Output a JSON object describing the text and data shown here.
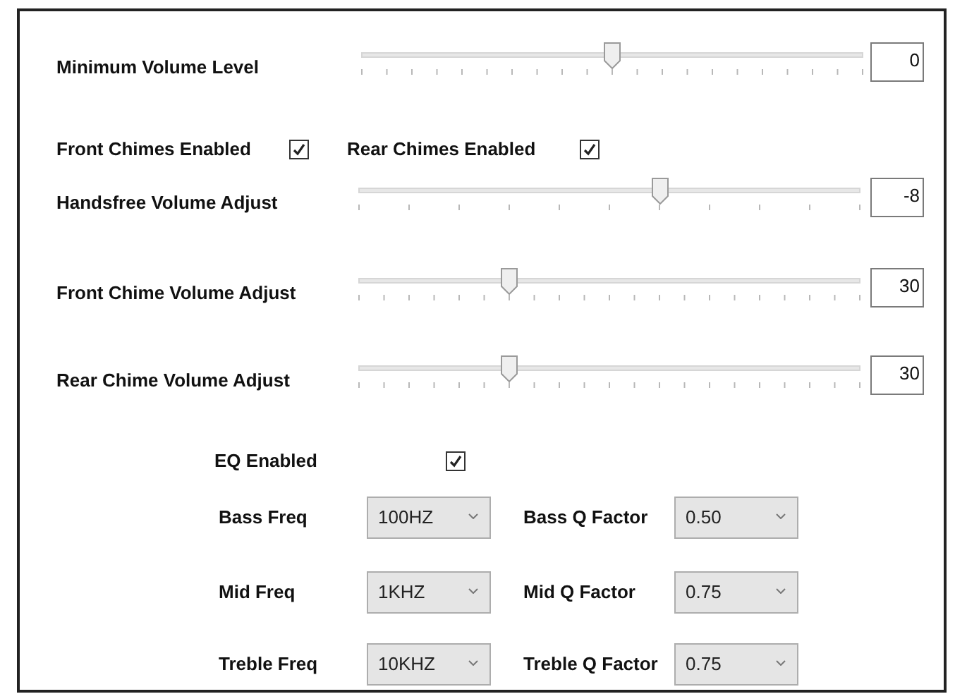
{
  "minimum_volume": {
    "label": "Minimum Volume Level",
    "kind": "fine",
    "level": 0.5,
    "value": "0"
  },
  "chimes": [
    {
      "label": "Front Chimes Enabled",
      "checked": true
    },
    {
      "label": "Rear Chimes Enabled",
      "checked": true
    }
  ],
  "adjustments": [
    {
      "label": "Handsfree Volume Adjust",
      "kind": "coarse",
      "level": 0.6,
      "value": "-8"
    },
    {
      "label": "Front Chime Volume Adjust",
      "kind": "fine",
      "level": 0.3,
      "value": "30"
    },
    {
      "label": "Rear Chime Volume Adjust",
      "kind": "fine",
      "level": 0.3,
      "value": "30"
    }
  ],
  "eq": {
    "label": "EQ Enabled",
    "checked": true
  },
  "eq_settings": [
    {
      "label": "Bass Freq",
      "value": "100HZ",
      "q_label": "Bass Q Factor",
      "q_value": "0.50"
    },
    {
      "label": "Mid Freq",
      "value": "1KHZ",
      "q_label": "Mid Q Factor",
      "q_value": "0.75"
    },
    {
      "label": "Treble Freq",
      "value": "10KHZ",
      "q_label": "Treble Q Factor",
      "q_value": "0.75"
    }
  ]
}
